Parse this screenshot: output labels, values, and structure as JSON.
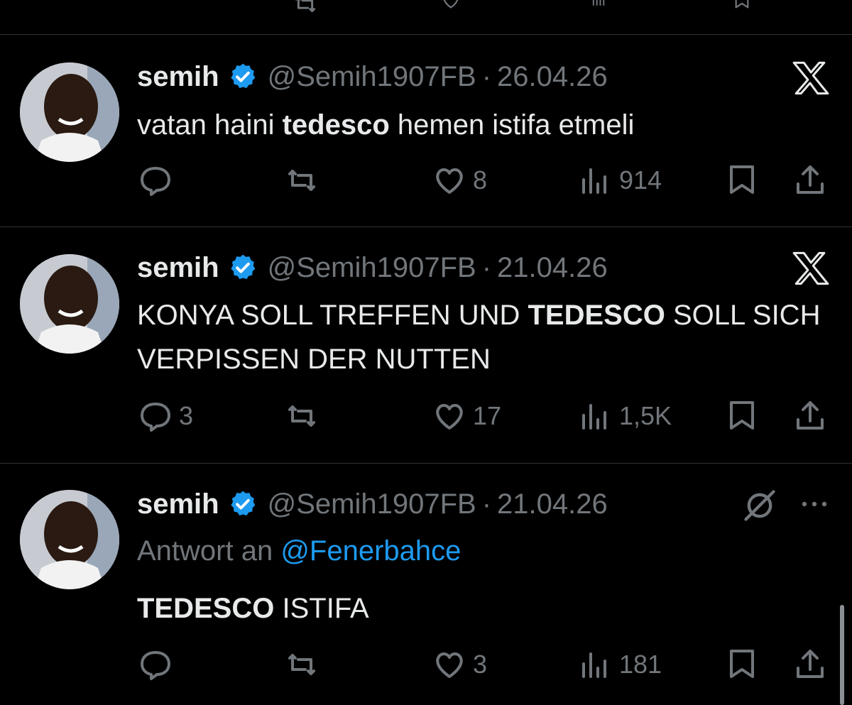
{
  "tweets": [
    {
      "name": "semih",
      "handle": "@Semih1907FB",
      "separator": "·",
      "date": "26.04.26",
      "text_parts": [
        "vatan haini ",
        "tedesco",
        " hemen istifa etmeli"
      ],
      "replies": "",
      "likes": "8",
      "views": "914",
      "top_right_icon": "x-logo-icon"
    },
    {
      "name": "semih",
      "handle": "@Semih1907FB",
      "separator": "·",
      "date": "21.04.26",
      "text_parts": [
        "KONYA SOLL TREFFEN UND ",
        "TEDESCO",
        " SOLL SICH VERPISSEN DER NUTTEN"
      ],
      "replies": "3",
      "likes": "17",
      "views": "1,5K",
      "top_right_icon": "x-logo-icon"
    },
    {
      "name": "semih",
      "handle": "@Semih1907FB",
      "separator": "·",
      "date": "21.04.26",
      "reply_prefix": "Antwort an ",
      "reply_mention": "@Fenerbahce",
      "text_parts": [
        "",
        "TEDESCO",
        " ISTIFA"
      ],
      "replies": "",
      "likes": "3",
      "views": "181",
      "top_right_icon": "grok-icon",
      "menu_icon": "more-icon"
    }
  ],
  "colors": {
    "background": "#000000",
    "text": "#e7e9ea",
    "muted": "#71767b",
    "divider": "#2f3336",
    "accent": "#1d9bf0"
  }
}
